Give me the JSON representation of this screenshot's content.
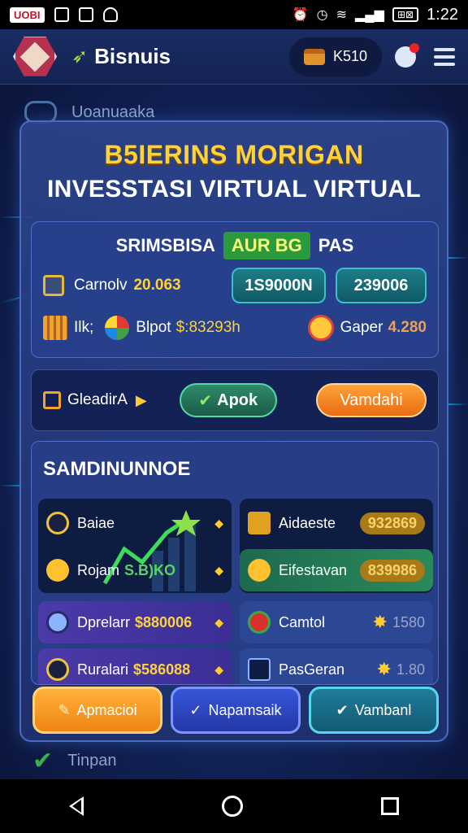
{
  "statusbar": {
    "carrier_badge": "UOBI",
    "time": "1:22",
    "battery": "⊞⊠"
  },
  "header": {
    "brand": "Bisnuis",
    "coins": "K510"
  },
  "ghost": {
    "top_label": "Uoanuaaka",
    "bottom_label": "Tinpan"
  },
  "hero": {
    "title_yellow": "B5IERINS MORIGAN",
    "title_white": "INVESSTASI VIRTUAL VIRTUAL"
  },
  "stats": {
    "head_left": "SRIMSBISA",
    "head_highlight": "AUR BG",
    "head_right": "PAS",
    "row1": {
      "label": "Carnolv",
      "value": "20.063",
      "pill1": "1S9000N",
      "pill2": "239006"
    },
    "row2": {
      "label_a": "Ilk;",
      "label_b": "Blpot",
      "value_b": "$:83293h",
      "label_c": "Gaper",
      "value_c": "4.280"
    }
  },
  "actions": {
    "label": "GleadirA",
    "green_btn": "Apok",
    "orange_btn": "Vamdahi"
  },
  "summary": {
    "title": "SAMDINUNNOE",
    "left": [
      {
        "name": "Baiae",
        "amount": ""
      },
      {
        "name": "Rojam",
        "amount": "S.B)KO"
      },
      {
        "name": "Dprelarr",
        "amount": "$880006"
      },
      {
        "name": "Ruralari",
        "amount": "$586088"
      }
    ],
    "right": [
      {
        "name": "Aidaeste",
        "amount": "932869"
      },
      {
        "name": "Eifestavan",
        "amount": "839986"
      },
      {
        "name": "Camtol",
        "amount": "1580"
      },
      {
        "name": "PasGeran",
        "amount": "1.80"
      }
    ]
  },
  "bottom_buttons": {
    "b1": "Apmacioi",
    "b2": "Napamsaik",
    "b3": "Vambanl"
  },
  "colors": {
    "accent_yellow": "#ffd23a",
    "accent_orange": "#f08414",
    "panel_blue": "#28408c",
    "green": "#2b9a3c"
  }
}
